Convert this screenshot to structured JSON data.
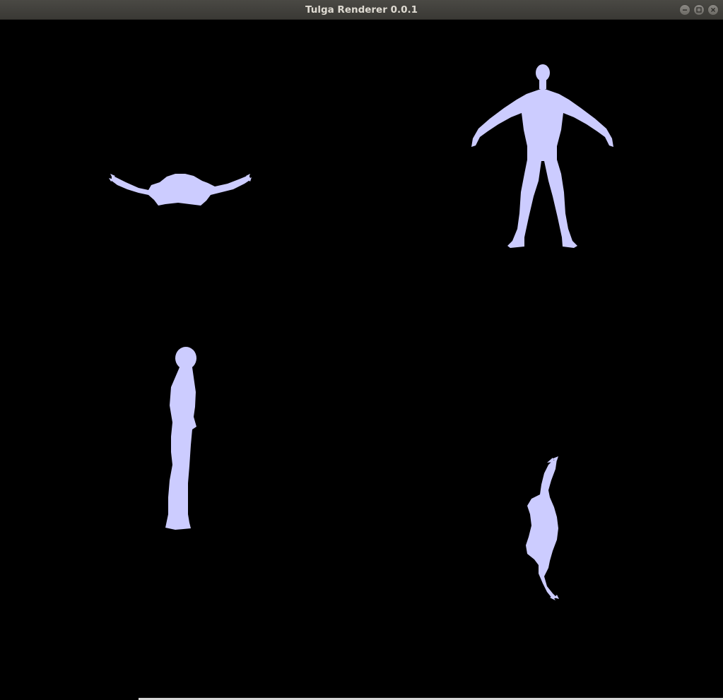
{
  "window": {
    "title": "Tulga Renderer 0.0.1",
    "controls": [
      {
        "name": "minimize-button",
        "icon": "minimize-icon"
      },
      {
        "name": "maximize-button",
        "icon": "maximize-icon"
      },
      {
        "name": "close-button",
        "icon": "close-icon"
      }
    ]
  },
  "scene": {
    "background_color": "#000000",
    "model_color": "#ccccff",
    "views": [
      {
        "name": "figure-top-left-view",
        "label": "top-down view, arms outstretched"
      },
      {
        "name": "figure-front-view",
        "label": "front view, T-pose"
      },
      {
        "name": "figure-side-view",
        "label": "side view, standing"
      },
      {
        "name": "figure-top-rotated-view",
        "label": "top-down rotated view"
      }
    ]
  }
}
